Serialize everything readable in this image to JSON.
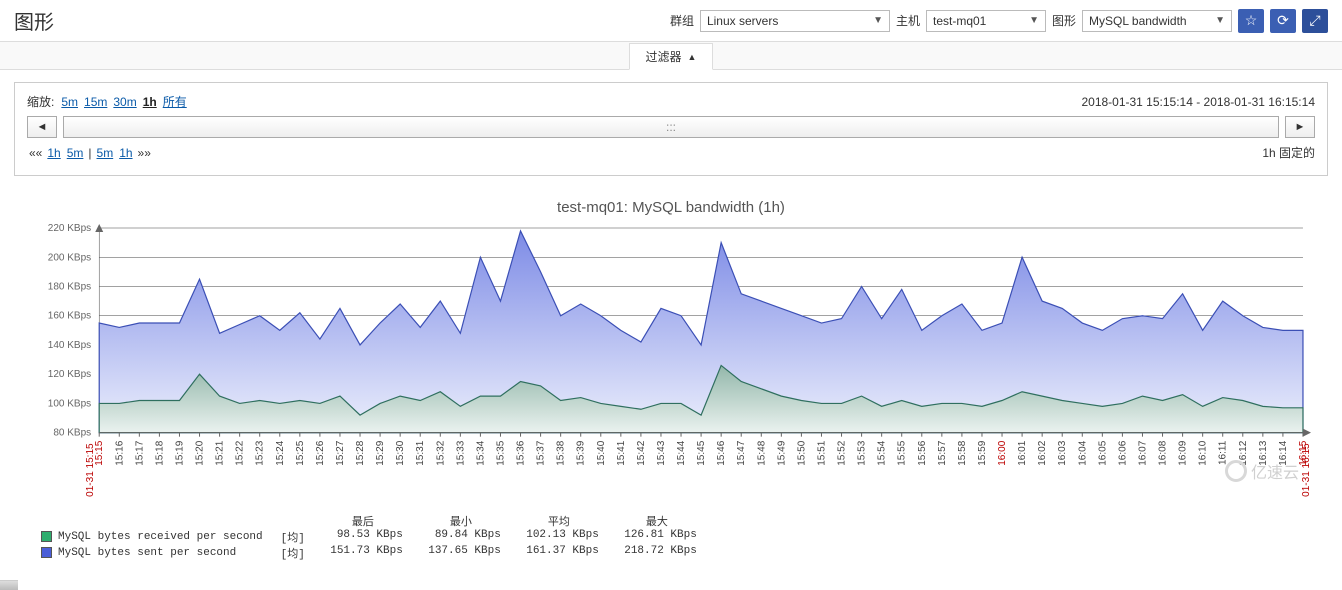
{
  "header": {
    "title": "图形",
    "group_label": "群组",
    "group_value": "Linux servers",
    "host_label": "主机",
    "host_value": "test-mq01",
    "graph_label": "图形",
    "graph_value": "MySQL bandwidth",
    "icons": {
      "star": "☆",
      "refresh": "⟳",
      "fullscreen": "⤢"
    }
  },
  "filter_tab": {
    "label": "过滤器",
    "arrow": "▲"
  },
  "zoom": {
    "label": "缩放:",
    "opts": [
      "5m",
      "15m",
      "30m",
      "1h",
      "所有"
    ],
    "active": "1h",
    "range": "2018-01-31 15:15:14 - 2018-01-31 16:15:14"
  },
  "nav": {
    "left": "◄",
    "mid": ":::",
    "right": "►"
  },
  "fine": {
    "left_chevs": "««",
    "l1": "1h",
    "l2": "5m",
    "sep": "|",
    "r1": "5m",
    "r2": "1h",
    "right_chevs": "»»",
    "fixed": "1h 固定的"
  },
  "chart_title": "test-mq01: MySQL bandwidth (1h)",
  "chart_data": {
    "type": "area",
    "title": "test-mq01: MySQL bandwidth (1h)",
    "ylabel": "KBps",
    "ylim": [
      80,
      220
    ],
    "y_ticks": [
      80,
      100,
      120,
      140,
      160,
      180,
      200,
      220
    ],
    "x_start_label": "01-31 15:15",
    "x_end_label": "01-31 16:15",
    "categories": [
      "15:15",
      "15:16",
      "15:17",
      "15:18",
      "15:19",
      "15:20",
      "15:21",
      "15:22",
      "15:23",
      "15:24",
      "15:25",
      "15:26",
      "15:27",
      "15:28",
      "15:29",
      "15:30",
      "15:31",
      "15:32",
      "15:33",
      "15:34",
      "15:35",
      "15:36",
      "15:37",
      "15:38",
      "15:39",
      "15:40",
      "15:41",
      "15:42",
      "15:43",
      "15:44",
      "15:45",
      "15:46",
      "15:47",
      "15:48",
      "15:49",
      "15:50",
      "15:51",
      "15:52",
      "15:53",
      "15:54",
      "15:55",
      "15:56",
      "15:57",
      "15:58",
      "15:59",
      "16:00",
      "16:01",
      "16:02",
      "16:03",
      "16:04",
      "16:05",
      "16:06",
      "16:07",
      "16:08",
      "16:09",
      "16:10",
      "16:11",
      "16:12",
      "16:13",
      "16:14",
      "16:15"
    ],
    "red_ticks": [
      "15:15",
      "16:00",
      "16:15"
    ],
    "series": [
      {
        "name": "MySQL bytes sent per second",
        "color": "#5c6fd8",
        "values": [
          155,
          152,
          155,
          155,
          155,
          185,
          148,
          154,
          160,
          150,
          162,
          144,
          165,
          140,
          155,
          168,
          152,
          170,
          148,
          200,
          170,
          218,
          190,
          160,
          168,
          160,
          150,
          142,
          165,
          160,
          140,
          210,
          175,
          170,
          165,
          160,
          155,
          158,
          180,
          158,
          178,
          150,
          160,
          168,
          150,
          155,
          200,
          170,
          165,
          155,
          150,
          158,
          160,
          158,
          175,
          150,
          170,
          160,
          152,
          150,
          150
        ]
      },
      {
        "name": "MySQL bytes received per second",
        "color": "#3a9471",
        "values": [
          100,
          100,
          102,
          102,
          102,
          120,
          105,
          100,
          102,
          100,
          102,
          100,
          105,
          92,
          100,
          105,
          102,
          108,
          98,
          105,
          105,
          115,
          112,
          102,
          104,
          100,
          98,
          96,
          100,
          100,
          92,
          126,
          115,
          110,
          105,
          102,
          100,
          100,
          105,
          98,
          102,
          98,
          100,
          100,
          98,
          102,
          108,
          105,
          102,
          100,
          98,
          100,
          105,
          102,
          106,
          98,
          104,
          102,
          98,
          97,
          97
        ]
      }
    ],
    "stats": {
      "columns": [
        "最后",
        "最小",
        "平均",
        "最大"
      ],
      "rows": [
        {
          "name": "MySQL bytes received per second",
          "values": [
            "98.53 KBps",
            "89.84 KBps",
            "102.13 KBps",
            "126.81 KBps"
          ]
        },
        {
          "name": "MySQL bytes sent per second",
          "values": [
            "151.73 KBps",
            "137.65 KBps",
            "161.37 KBps",
            "218.72 KBps"
          ]
        }
      ],
      "row_prefix": "[均]"
    }
  },
  "colors": {
    "recv_fill_top": "#9fbfb4",
    "recv_fill_bot": "#e6efec",
    "sent_fill_top": "#8e9ae6",
    "sent_fill_bot": "#e9ecfa"
  },
  "watermark": "亿速云"
}
